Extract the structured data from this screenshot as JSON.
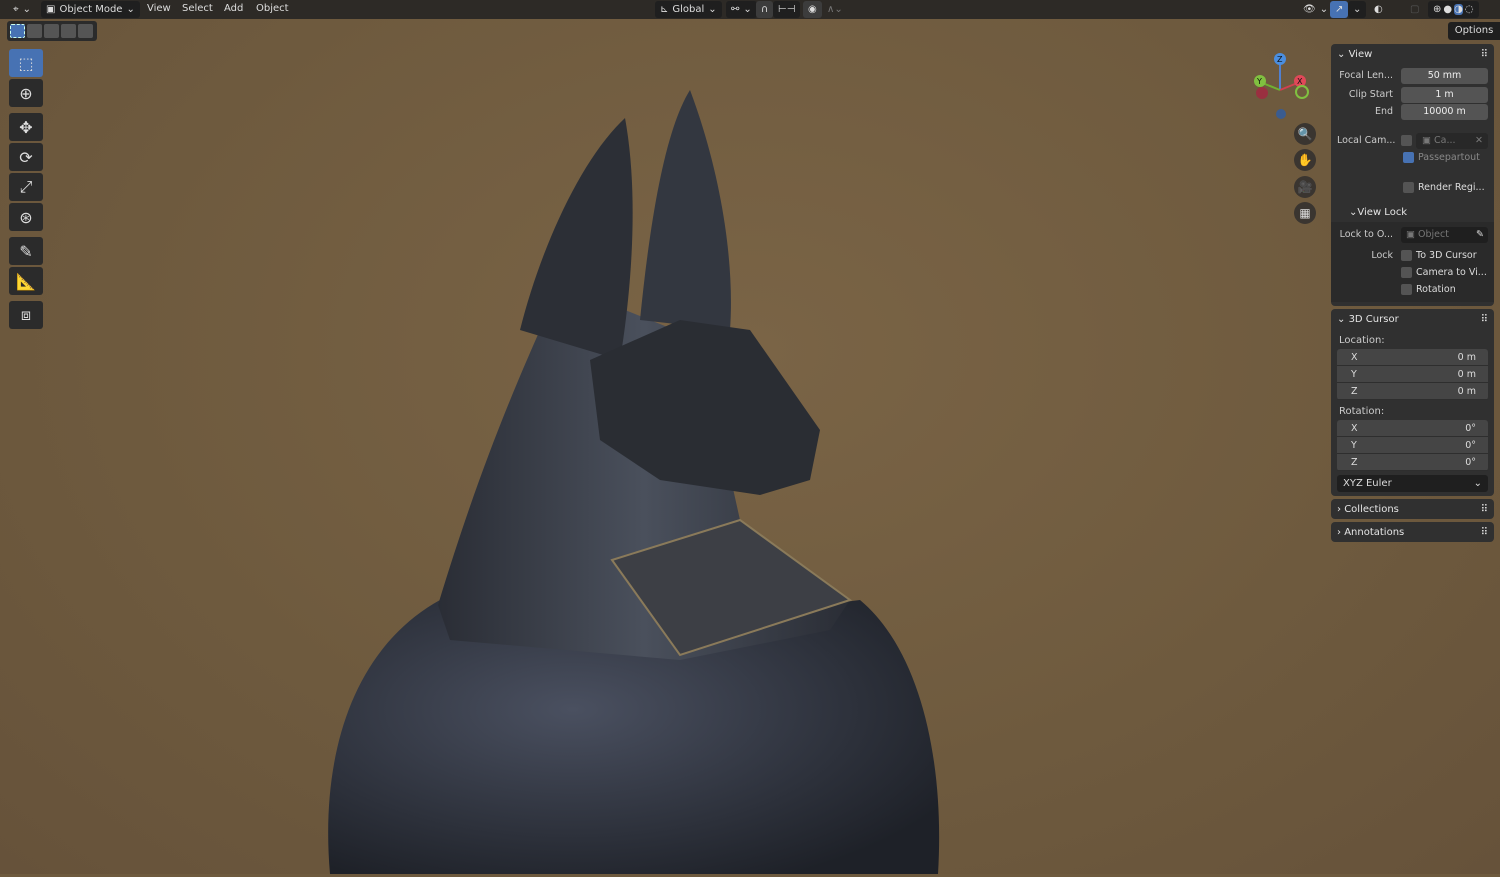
{
  "header": {
    "mode": "Object Mode",
    "menus": [
      "View",
      "Select",
      "Add",
      "Object"
    ],
    "transform_orientation": "Global",
    "options": "Options"
  },
  "view_panel": {
    "title": "View",
    "focal_length_label": "Focal Len...",
    "focal_length": "50 mm",
    "clip_start_label": "Clip Start",
    "clip_start": "1 m",
    "clip_end_label": "End",
    "clip_end": "10000 m",
    "local_camera_label": "Local Cam...",
    "local_camera_value": "Ca...",
    "passepartout": "Passepartout",
    "render_region": "Render Regi...",
    "view_lock": {
      "title": "View Lock",
      "lock_to_object_label": "Lock to O...",
      "lock_to_object_placeholder": "Object",
      "lock_label": "Lock",
      "to_3d_cursor": "To 3D Cursor",
      "camera_to_view": "Camera to Vi...",
      "rotation": "Rotation"
    }
  },
  "cursor_panel": {
    "title": "3D Cursor",
    "location_label": "Location:",
    "location": [
      {
        "axis": "X",
        "value": "0 m"
      },
      {
        "axis": "Y",
        "value": "0 m"
      },
      {
        "axis": "Z",
        "value": "0 m"
      }
    ],
    "rotation_label": "Rotation:",
    "rotation": [
      {
        "axis": "X",
        "value": "0°"
      },
      {
        "axis": "Y",
        "value": "0°"
      },
      {
        "axis": "Z",
        "value": "0°"
      }
    ],
    "rotation_mode": "XYZ Euler"
  },
  "collapsed_panels": [
    "Collections",
    "Annotations"
  ],
  "gizmo": {
    "x": "X",
    "y": "Y",
    "z": "Z"
  },
  "colors": {
    "accent": "#4772b3",
    "background": "#6e5a3e"
  }
}
